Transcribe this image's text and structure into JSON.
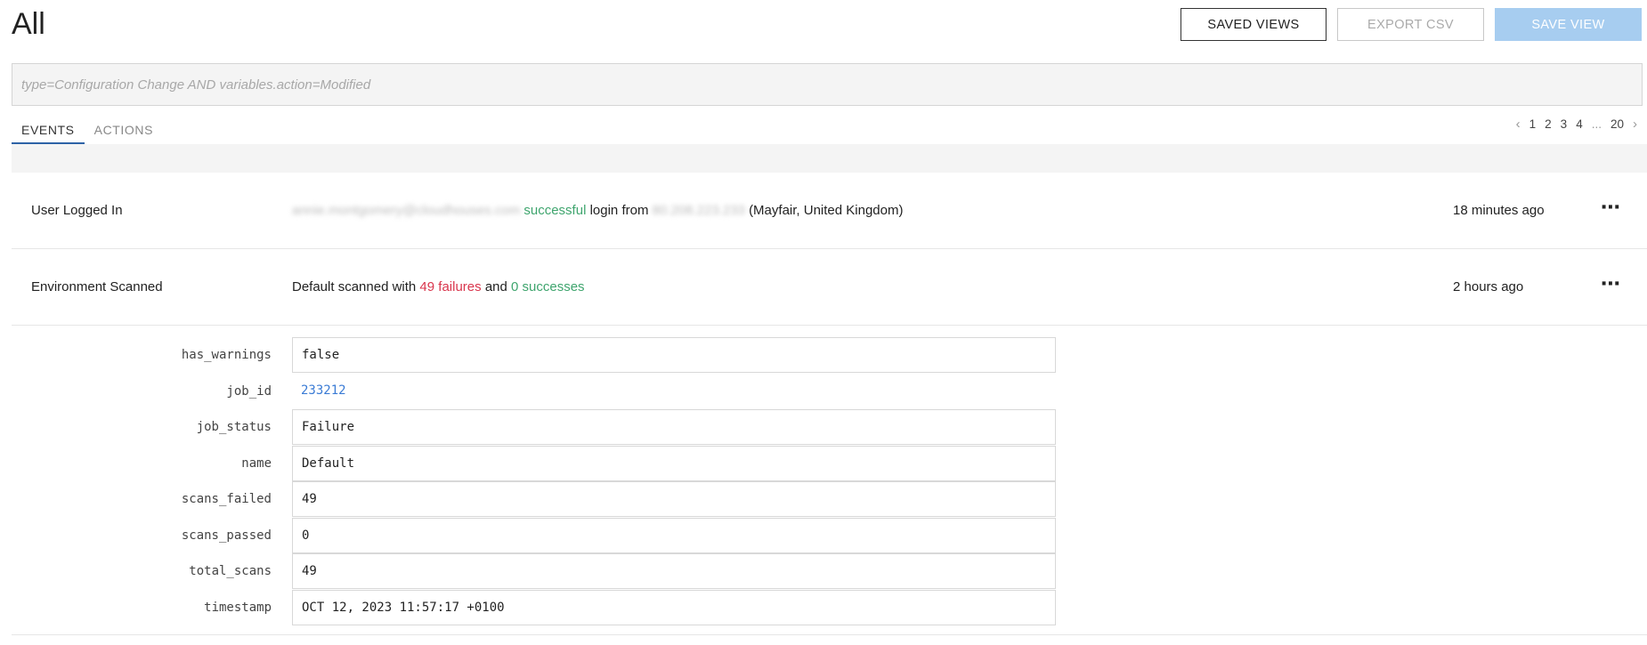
{
  "page": {
    "title": "All"
  },
  "toolbar": {
    "saved_views": "SAVED VIEWS",
    "export_csv": "EXPORT CSV",
    "save_view": "SAVE VIEW"
  },
  "search": {
    "placeholder": "type=Configuration Change AND variables.action=Modified",
    "value": ""
  },
  "tabs": [
    {
      "label": "EVENTS",
      "active": true
    },
    {
      "label": "ACTIONS",
      "active": false
    }
  ],
  "pagination": {
    "prev": "‹",
    "pages": [
      "1",
      "2",
      "3",
      "4"
    ],
    "ellipsis": "...",
    "last": "20",
    "next": "›"
  },
  "events": [
    {
      "type": "User Logged In",
      "user_redacted": "annie.montgomery@cloudhouses.com",
      "status": "successful",
      "middle": "login from",
      "ip_redacted": "80.208.223.233",
      "location": "(Mayfair, United Kingdom)",
      "time": "18 minutes ago"
    },
    {
      "type": "Environment Scanned",
      "prefix": "Default scanned with",
      "failures": "49 failures",
      "and": "and",
      "successes": "0 successes",
      "time": "2 hours ago"
    }
  ],
  "more_icon": "⋯",
  "details": [
    {
      "key": "has_warnings",
      "value": "false"
    },
    {
      "key": "job_id",
      "value": "233212",
      "link": true
    },
    {
      "key": "job_status",
      "value": "Failure"
    },
    {
      "key": "name",
      "value": "Default"
    },
    {
      "key": "scans_failed",
      "value": "49"
    },
    {
      "key": "scans_passed",
      "value": "0"
    },
    {
      "key": "total_scans",
      "value": "49"
    },
    {
      "key": "timestamp",
      "value": "OCT 12, 2023 11:57:17 +0100"
    }
  ],
  "colors": {
    "success": "#3fa56e",
    "failure": "#d9364d",
    "link": "#3a7bd5",
    "accent": "#2d63a6"
  }
}
